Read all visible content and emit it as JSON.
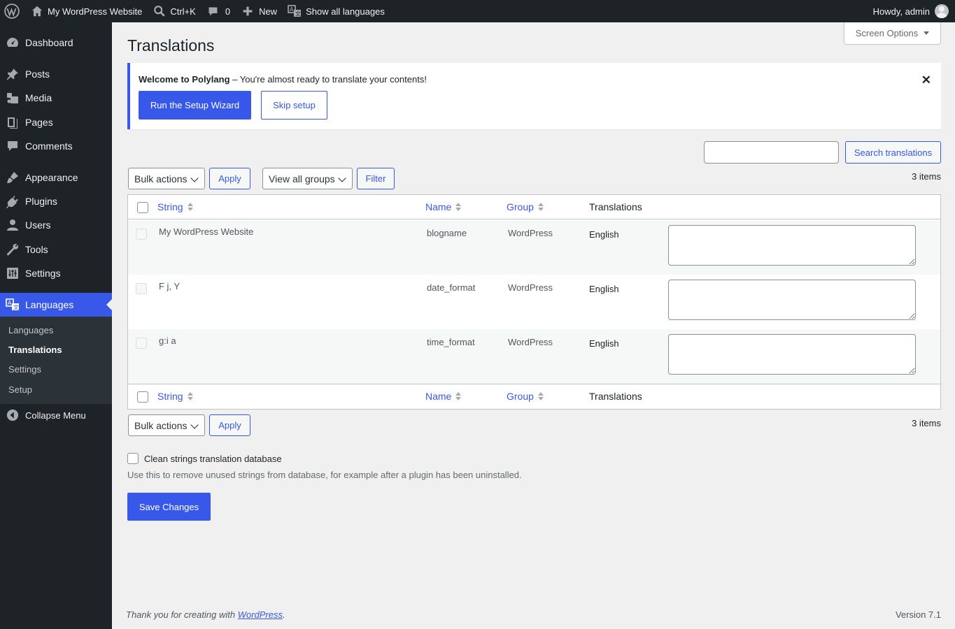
{
  "adminbar": {
    "site_name": "My WordPress Website",
    "search_shortcut": "Ctrl+K",
    "comments_count": "0",
    "new_label": "New",
    "languages_label": "Show all languages",
    "howdy": "Howdy, admin"
  },
  "sidebar": {
    "items": [
      {
        "label": "Dashboard",
        "icon": "dashboard-icon"
      },
      {
        "label": "Posts",
        "icon": "pin-icon"
      },
      {
        "label": "Media",
        "icon": "media-icon"
      },
      {
        "label": "Pages",
        "icon": "pages-icon"
      },
      {
        "label": "Comments",
        "icon": "comment-icon"
      },
      {
        "label": "Appearance",
        "icon": "brush-icon"
      },
      {
        "label": "Plugins",
        "icon": "plugin-icon"
      },
      {
        "label": "Users",
        "icon": "user-icon"
      },
      {
        "label": "Tools",
        "icon": "wrench-icon"
      },
      {
        "label": "Settings",
        "icon": "settings-icon"
      },
      {
        "label": "Languages",
        "icon": "translate-icon"
      }
    ],
    "submenu": [
      "Languages",
      "Translations",
      "Settings",
      "Setup"
    ],
    "collapse": "Collapse Menu"
  },
  "screen_options": "Screen Options",
  "page_title": "Translations",
  "notice": {
    "bold": "Welcome to Polylang",
    "text": " – You're almost ready to translate your contents!",
    "primary_button": "Run the Setup Wizard",
    "secondary_button": "Skip setup",
    "dismiss": "✕"
  },
  "search": {
    "value": "",
    "button": "Search translations"
  },
  "toolbar": {
    "bulk_actions": "Bulk actions",
    "apply": "Apply",
    "group_filter": "View all groups",
    "filter": "Filter",
    "items_count": "3 items"
  },
  "table": {
    "columns": [
      "String",
      "Name",
      "Group",
      "Translations"
    ],
    "rows": [
      {
        "string": "My WordPress Website",
        "name": "blogname",
        "group": "WordPress",
        "language": "English",
        "translation": ""
      },
      {
        "string": "F j, Y",
        "name": "date_format",
        "group": "WordPress",
        "language": "English",
        "translation": ""
      },
      {
        "string": "g:i a",
        "name": "time_format",
        "group": "WordPress",
        "language": "English",
        "translation": ""
      }
    ]
  },
  "clean": {
    "label": "Clean strings translation database",
    "description": "Use this to remove unused strings from database, for example after a plugin has been uninstalled."
  },
  "save_button": "Save Changes",
  "footer": {
    "thanks_prefix": "Thank you for creating with ",
    "thanks_link": "WordPress",
    "thanks_suffix": ".",
    "version": "Version 7.1"
  },
  "colors": {
    "accent": "#3858e9",
    "sidebar_bg": "#1d2327",
    "page_bg": "#f0f0f1"
  }
}
